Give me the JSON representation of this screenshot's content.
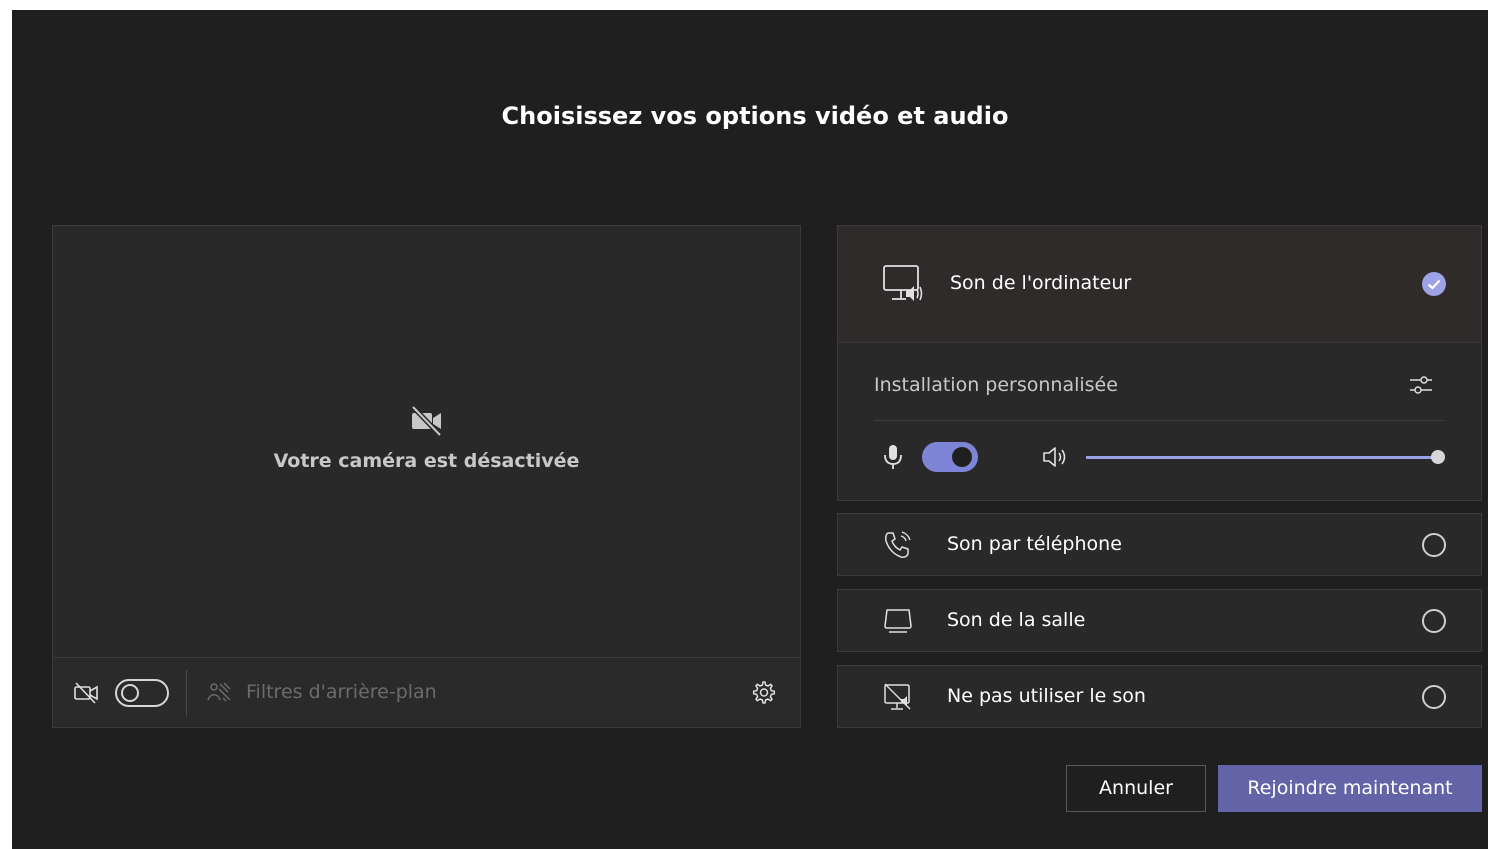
{
  "title": "Choisissez vos options vidéo et audio",
  "video": {
    "camera_off_text": "Votre caméra est désactivée",
    "camera_toggle_on": false,
    "background_filters_label": "Filtres d'arrière-plan"
  },
  "audio": {
    "computer_audio_label": "Son de l'ordinateur",
    "computer_audio_selected": true,
    "custom_setup_label": "Installation personnalisée",
    "mic_on": true,
    "volume_percent": 100,
    "options": [
      {
        "label": "Son par téléphone",
        "icon": "phone-audio-icon",
        "selected": false
      },
      {
        "label": "Son de la salle",
        "icon": "room-audio-icon",
        "selected": false
      },
      {
        "label": "Ne pas utiliser le son",
        "icon": "no-audio-icon",
        "selected": false
      }
    ]
  },
  "buttons": {
    "cancel": "Annuler",
    "join": "Rejoindre maintenant"
  },
  "colors": {
    "background": "#1f1f1f",
    "panel": "#292929",
    "accent": "#6264a7",
    "toggle_on": "#7f85d6"
  }
}
